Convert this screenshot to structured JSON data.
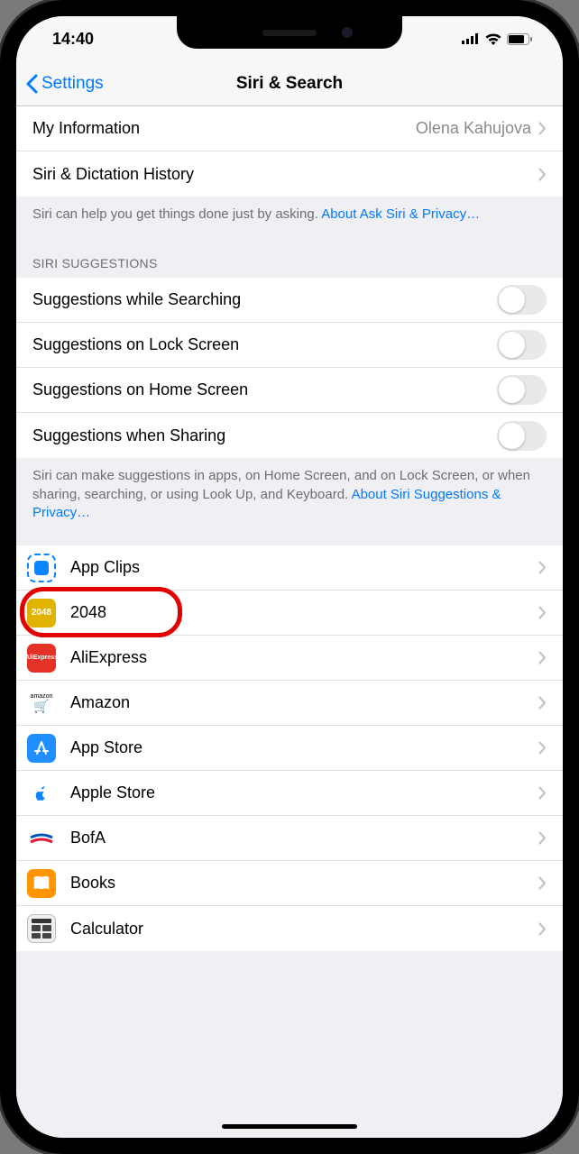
{
  "statusbar": {
    "time": "14:40"
  },
  "nav": {
    "back": "Settings",
    "title": "Siri & Search"
  },
  "info_group": {
    "my_info_label": "My Information",
    "my_info_value": "Olena Kahujova",
    "history_label": "Siri & Dictation History",
    "footer_text": "Siri can help you get things done just by asking. ",
    "footer_link": "About Ask Siri & Privacy…"
  },
  "suggestions": {
    "header": "SIRI SUGGESTIONS",
    "items": [
      "Suggestions while Searching",
      "Suggestions on Lock Screen",
      "Suggestions on Home Screen",
      "Suggestions when Sharing"
    ],
    "footer_text": "Siri can make suggestions in apps, on Home Screen, and on Lock Screen, or when sharing, searching, or using Look Up, and Keyboard. ",
    "footer_link": "About Siri Suggestions & Privacy…"
  },
  "apps": [
    {
      "name": "App Clips",
      "icon": "appclips"
    },
    {
      "name": "2048",
      "icon": "2048",
      "highlighted": true
    },
    {
      "name": "AliExpress",
      "icon": "ali"
    },
    {
      "name": "Amazon",
      "icon": "amazon"
    },
    {
      "name": "App Store",
      "icon": "appstore"
    },
    {
      "name": "Apple Store",
      "icon": "apple"
    },
    {
      "name": "BofA",
      "icon": "bofa"
    },
    {
      "name": "Books",
      "icon": "books"
    },
    {
      "name": "Calculator",
      "icon": "calc"
    }
  ]
}
